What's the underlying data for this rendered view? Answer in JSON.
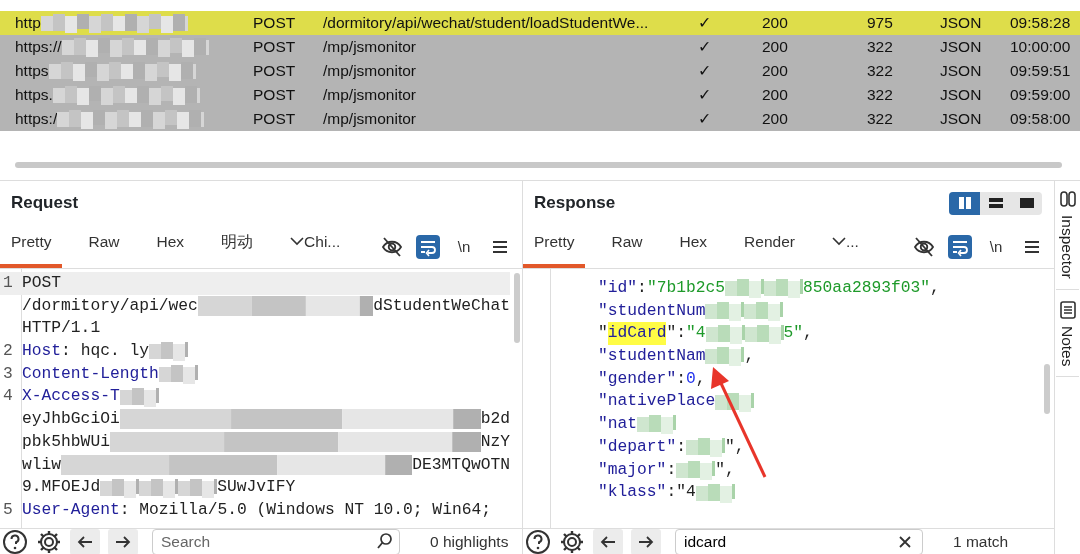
{
  "history": {
    "rows": [
      {
        "host": "http",
        "redacted": true,
        "method": "POST",
        "url": "/dormitory/api/wechat/student/loadStudentWe...",
        "edited": "✓",
        "status": "200",
        "length": "975",
        "mime": "JSON",
        "time": "09:58:28",
        "color": "#dedd4a"
      },
      {
        "host": "https://",
        "redacted": true,
        "method": "POST",
        "url": "/mp/jsmonitor",
        "edited": "✓",
        "status": "200",
        "length": "322",
        "mime": "JSON",
        "time": "10:00:00",
        "color": "#b4b4b4"
      },
      {
        "host": "https",
        "redacted": true,
        "method": "POST",
        "url": "/mp/jsmonitor",
        "edited": "✓",
        "status": "200",
        "length": "322",
        "mime": "JSON",
        "time": "09:59:51",
        "color": "#b4b4b4"
      },
      {
        "host": "https.",
        "redacted": true,
        "method": "POST",
        "url": "/mp/jsmonitor",
        "edited": "✓",
        "status": "200",
        "length": "322",
        "mime": "JSON",
        "time": "09:59:00",
        "color": "#b4b4b4"
      },
      {
        "host": "https:/",
        "redacted": true,
        "method": "POST",
        "url": "/mp/jsmonitor",
        "edited": "✓",
        "status": "200",
        "length": "322",
        "mime": "JSON",
        "time": "09:58:00",
        "color": "#b4b4b4"
      }
    ]
  },
  "request": {
    "title": "Request",
    "tabs": [
      {
        "label": "Pretty",
        "selected": true
      },
      {
        "label": "Raw",
        "selected": false
      },
      {
        "label": "Hex",
        "selected": false
      },
      {
        "label": "明动",
        "selected": false
      },
      {
        "label": "Chi...",
        "selected": false,
        "dropdown": true
      }
    ],
    "wrap_on": true,
    "newline": "\\n",
    "lines": [
      {
        "num": "1",
        "current": true,
        "segments": [
          {
            "kind": "plain",
            "text": "POST"
          }
        ]
      },
      {
        "wrapped": true,
        "segments": [
          {
            "kind": "plain",
            "text": "/dormitory/api/wec"
          },
          {
            "kind": "blur"
          },
          {
            "kind": "plain",
            "text": "dStudentWeChat"
          }
        ]
      },
      {
        "segments": [
          {
            "kind": "plain",
            "text": "HTTP/1.1"
          }
        ]
      },
      {
        "num": "2",
        "segments": [
          {
            "kind": "key",
            "text": "Host"
          },
          {
            "kind": "plain",
            "text": ": hqc. ly"
          },
          {
            "kind": "blur"
          }
        ]
      },
      {
        "num": "3",
        "segments": [
          {
            "kind": "key",
            "text": "Content-Length"
          },
          {
            "kind": "blur"
          }
        ]
      },
      {
        "num": "4",
        "segments": [
          {
            "kind": "key",
            "text": "X-Access-T"
          },
          {
            "kind": "blur"
          }
        ]
      },
      {
        "wrapped": true,
        "segments": [
          {
            "kind": "plain",
            "text": "eyJhbGciOi"
          },
          {
            "kind": "blur"
          },
          {
            "kind": "plain",
            "text": "b2d"
          }
        ]
      },
      {
        "wrapped": true,
        "segments": [
          {
            "kind": "plain",
            "text": "pbk5hbWUi"
          },
          {
            "kind": "blur"
          },
          {
            "kind": "plain",
            "text": "NzY"
          }
        ]
      },
      {
        "wrapped": true,
        "segments": [
          {
            "kind": "plain",
            "text": "wliw"
          },
          {
            "kind": "blur"
          },
          {
            "kind": "plain",
            "text": "DE3MTQwOTN"
          }
        ]
      },
      {
        "segments": [
          {
            "kind": "plain",
            "text": "9.MFOEJd"
          },
          {
            "kind": "blur"
          },
          {
            "kind": "blur"
          },
          {
            "kind": "blur"
          },
          {
            "kind": "plain",
            "text": "SUwJvIFY"
          }
        ]
      },
      {
        "num": "5",
        "segments": [
          {
            "kind": "key",
            "text": "User-Agent"
          },
          {
            "kind": "plain",
            "text": ": Mozilla/5.0 (Windows NT 10.0; Win64;"
          }
        ]
      }
    ],
    "search": {
      "placeholder": "Search"
    },
    "result": "0 highlights"
  },
  "response": {
    "title": "Response",
    "layout": [
      {
        "selected": true
      },
      {
        "selected": false
      },
      {
        "selected": false
      }
    ],
    "tabs": [
      {
        "label": "Pretty",
        "selected": true
      },
      {
        "label": "Raw",
        "selected": false
      },
      {
        "label": "Hex",
        "selected": false
      },
      {
        "label": "Render",
        "selected": false
      },
      {
        "label": "...",
        "selected": false,
        "dropdown": true
      }
    ],
    "wrap_on": true,
    "newline": "\\n",
    "lines": [
      {
        "segments": [
          {
            "kind": "key",
            "text": "\"id\""
          },
          {
            "kind": "plain",
            "text": ":"
          },
          {
            "kind": "str",
            "text": "\"7b1b2c5"
          },
          {
            "kind": "blur"
          },
          {
            "kind": "blur"
          },
          {
            "kind": "str",
            "text": "850aa2893f03\""
          },
          {
            "kind": "plain",
            "text": ","
          }
        ]
      },
      {
        "segments": [
          {
            "kind": "key",
            "text": "\"studentNum"
          },
          {
            "kind": "blur"
          },
          {
            "kind": "blur"
          }
        ]
      },
      {
        "segments": [
          {
            "kind": "plain",
            "text": "\""
          },
          {
            "kind": "match",
            "text": "idCard"
          },
          {
            "kind": "plain",
            "text": "\":"
          },
          {
            "kind": "str",
            "text": "\"4"
          },
          {
            "kind": "blur"
          },
          {
            "kind": "blur"
          },
          {
            "kind": "str",
            "text": "5\""
          },
          {
            "kind": "plain",
            "text": ","
          }
        ]
      },
      {
        "segments": [
          {
            "kind": "key",
            "text": "\"studentNam"
          },
          {
            "kind": "blur"
          },
          {
            "kind": "plain",
            "text": ","
          }
        ]
      },
      {
        "segments": [
          {
            "kind": "key",
            "text": "\"gender\""
          },
          {
            "kind": "plain",
            "text": ":"
          },
          {
            "kind": "num",
            "text": "0"
          },
          {
            "kind": "plain",
            "text": ","
          }
        ]
      },
      {
        "segments": [
          {
            "kind": "key",
            "text": "\"nativePlace"
          },
          {
            "kind": "blur"
          }
        ]
      },
      {
        "segments": [
          {
            "kind": "key",
            "text": "\"nat"
          },
          {
            "kind": "blur"
          }
        ]
      },
      {
        "segments": [
          {
            "kind": "key",
            "text": "\"depart\""
          },
          {
            "kind": "plain",
            "text": ":"
          },
          {
            "kind": "blur"
          },
          {
            "kind": "plain",
            "text": "\","
          }
        ]
      },
      {
        "segments": [
          {
            "kind": "key",
            "text": "\"major\""
          },
          {
            "kind": "plain",
            "text": ":"
          },
          {
            "kind": "blur"
          },
          {
            "kind": "plain",
            "text": "\","
          }
        ]
      },
      {
        "segments": [
          {
            "kind": "key",
            "text": "\"klass\""
          },
          {
            "kind": "plain",
            "text": ":\"4"
          },
          {
            "kind": "blur"
          }
        ]
      }
    ],
    "annotations": [
      {
        "kind": "arrow"
      }
    ],
    "search": {
      "value": "idcard"
    },
    "result": "1 match"
  },
  "sidebar": {
    "items": [
      {
        "label": "Inspector",
        "kind": "inspector"
      },
      {
        "label": "Notes",
        "kind": "notes"
      }
    ]
  }
}
